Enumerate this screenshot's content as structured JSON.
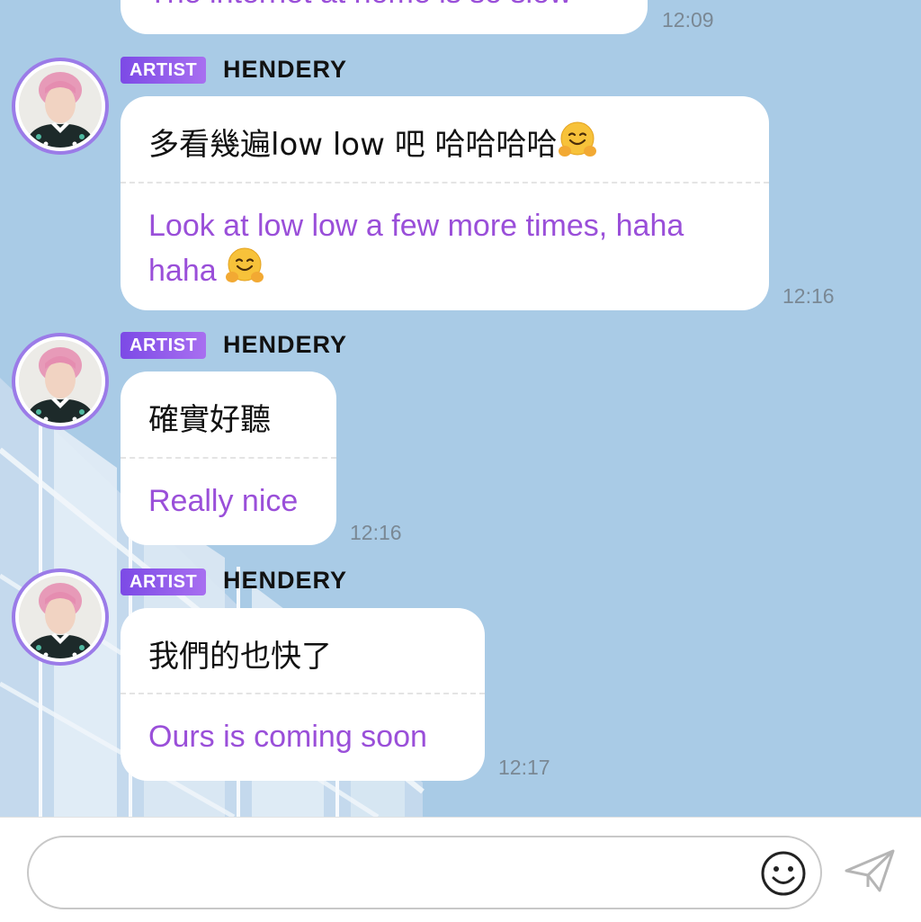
{
  "messages": [
    {
      "original": "The internet at home is so slow",
      "time": "12:09"
    },
    {
      "badge": "ARTIST",
      "sender": "HENDERY",
      "original": "多看幾遍low low 吧 哈哈哈哈",
      "translation": "Look at low low a few more times, haha haha",
      "emoji": "hugging-face",
      "time": "12:16"
    },
    {
      "badge": "ARTIST",
      "sender": "HENDERY",
      "original": "確實好聽",
      "translation": "Really nice",
      "time": "12:16"
    },
    {
      "badge": "ARTIST",
      "sender": "HENDERY",
      "original": "我們的也快了",
      "translation": "Ours is coming soon",
      "time": "12:17"
    }
  ],
  "composer": {
    "value": "",
    "placeholder": "",
    "emoji_icon": "smiley-icon",
    "send_icon": "paper-plane-icon"
  },
  "colors": {
    "chat_background": "#a9cbe6",
    "translation_text": "#9a4fd9",
    "badge_gradient_start": "#7c4ae6",
    "badge_gradient_end": "#a86ff0",
    "avatar_ring": "#9b7be8"
  }
}
